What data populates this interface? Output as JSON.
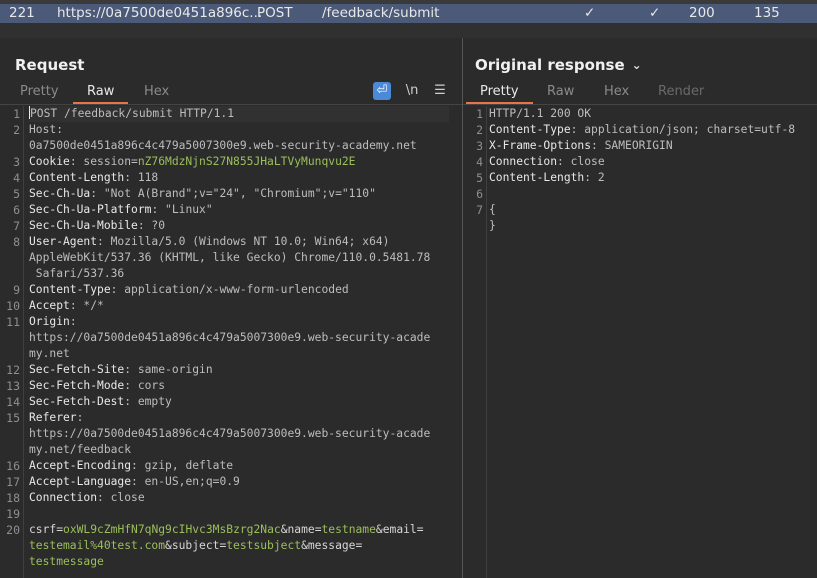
{
  "history_row": {
    "id": "221",
    "url": "https://0a7500de0451a896c...",
    "method": "POST",
    "path": "/feedback/submit",
    "check1": "✓",
    "check2": "✓",
    "status": "200",
    "length": "135"
  },
  "request": {
    "title": "Request",
    "tabs": [
      "Pretty",
      "Raw",
      "Hex"
    ],
    "active_tab": "Raw",
    "tools": {
      "wrap": "⏎",
      "newline": "\\n",
      "menu": "☰"
    },
    "lines": [
      {
        "n": "1",
        "text": "POST /feedback/submit HTTP/1.1"
      },
      {
        "n": "2",
        "text": "Host:"
      },
      {
        "n": "",
        "text": "0a7500de0451a896c4c479a5007300e9.web-security-academy.net"
      },
      {
        "n": "3",
        "key": "Cookie",
        "text": ": session=",
        "green": "nZ76MdzNjnS27N855JHaLTVyMunqvu2E"
      },
      {
        "n": "4",
        "key": "Content-Length",
        "text": ": 118"
      },
      {
        "n": "5",
        "key": "Sec-Ch-Ua",
        "text": ": \"Not A(Brand\";v=\"24\", \"Chromium\";v=\"110\""
      },
      {
        "n": "6",
        "key": "Sec-Ch-Ua-Platform",
        "text": ": \"Linux\""
      },
      {
        "n": "7",
        "key": "Sec-Ch-Ua-Mobile",
        "text": ": ?0"
      },
      {
        "n": "8",
        "key": "User-Agent",
        "text": ": Mozilla/5.0 (Windows NT 10.0; Win64; x64)"
      },
      {
        "n": "",
        "text": "AppleWebKit/537.36 (KHTML, like Gecko) Chrome/110.0.5481.78"
      },
      {
        "n": "",
        "text": " Safari/537.36"
      },
      {
        "n": "9",
        "key": "Content-Type",
        "text": ": application/x-www-form-urlencoded"
      },
      {
        "n": "10",
        "key": "Accept",
        "text": ": */*"
      },
      {
        "n": "11",
        "key": "Origin",
        "text": ":"
      },
      {
        "n": "",
        "text": "https://0a7500de0451a896c4c479a5007300e9.web-security-acade"
      },
      {
        "n": "",
        "text": "my.net"
      },
      {
        "n": "12",
        "key": "Sec-Fetch-Site",
        "text": ": same-origin"
      },
      {
        "n": "13",
        "key": "Sec-Fetch-Mode",
        "text": ": cors"
      },
      {
        "n": "14",
        "key": "Sec-Fetch-Dest",
        "text": ": empty"
      },
      {
        "n": "15",
        "key": "Referer",
        "text": ":"
      },
      {
        "n": "",
        "text": "https://0a7500de0451a896c4c479a5007300e9.web-security-acade"
      },
      {
        "n": "",
        "text": "my.net/feedback"
      },
      {
        "n": "16",
        "key": "Accept-Encoding",
        "text": ": gzip, deflate"
      },
      {
        "n": "17",
        "key": "Accept-Language",
        "text": ": en-US,en;q=0.9"
      },
      {
        "n": "18",
        "key": "Connection",
        "text": ": close"
      },
      {
        "n": "19",
        "text": ""
      },
      {
        "n": "20",
        "parts": [
          {
            "t": "csrf",
            "c": "k"
          },
          {
            "t": "=",
            "c": "k"
          },
          {
            "t": "oxWL9cZmHfN7qNg9cIHvc3MsBzrg2Nac",
            "c": "g"
          },
          {
            "t": "&name=",
            "c": "k"
          },
          {
            "t": "testname",
            "c": "g"
          },
          {
            "t": "&email=",
            "c": "k"
          }
        ]
      },
      {
        "n": "",
        "parts": [
          {
            "t": "testemail%40test.com",
            "c": "g"
          },
          {
            "t": "&subject=",
            "c": "k"
          },
          {
            "t": "testsubject",
            "c": "g"
          },
          {
            "t": "&message=",
            "c": "k"
          }
        ]
      },
      {
        "n": "",
        "parts": [
          {
            "t": "testmessage",
            "c": "g"
          }
        ]
      }
    ]
  },
  "response": {
    "title": "Original response",
    "chevron": "⌄",
    "tabs": [
      "Pretty",
      "Raw",
      "Hex",
      "Render"
    ],
    "active_tab": "Pretty",
    "lines": [
      {
        "n": "1",
        "text": "HTTP/1.1 200 OK"
      },
      {
        "n": "2",
        "key": "Content-Type",
        "text": ": application/json; charset=utf-8"
      },
      {
        "n": "3",
        "key": "X-Frame-Options",
        "text": ": SAMEORIGIN"
      },
      {
        "n": "4",
        "key": "Connection",
        "text": ": close"
      },
      {
        "n": "5",
        "key": "Content-Length",
        "text": ": 2"
      },
      {
        "n": "6",
        "text": ""
      },
      {
        "n": "7",
        "text": "{"
      },
      {
        "n": "",
        "text": "}"
      }
    ]
  },
  "colors": {
    "accent": "#e8744b",
    "selected_row": "#4a5a78",
    "value_green": "#9bbf5a"
  }
}
